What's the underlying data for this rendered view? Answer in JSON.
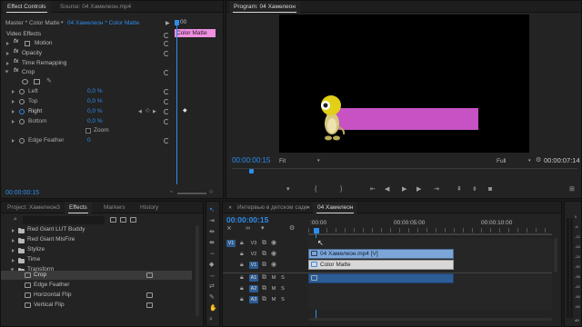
{
  "colors": {
    "accent": "#2d8ceb",
    "clip_pink": "#ef8fe0",
    "matte": "#c652c4",
    "clip_blue": "#7da6d8",
    "clip_matte_bg": "#d8d8d8",
    "video_track": "#2c5c93",
    "audio_track": "#2c5c93"
  },
  "effect_controls": {
    "tab_effect_controls": "Effect Controls",
    "tab_source": "Source: 04 Хамелеон.mp4",
    "master_label": "Master * Color Matte",
    "sequence_label": "04 Хамелеон * Color Matte",
    "ruler_time": "00",
    "clip_label": "Color Matte",
    "section_label": "Video Effects",
    "effects": [
      {
        "label": "Motion",
        "icon": "fx-badge"
      },
      {
        "label": "Opacity",
        "icon": "fx-badge"
      },
      {
        "label": "Time Remapping",
        "icon": "fx-badge"
      },
      {
        "label": "Crop",
        "icon": "fx-badge"
      }
    ],
    "crop_params": [
      {
        "label": "Left",
        "value": "0,0 %"
      },
      {
        "label": "Top",
        "value": "0,0 %"
      },
      {
        "label": "Right",
        "value": "0,0 %"
      },
      {
        "label": "Bottom",
        "value": "0,0 %"
      }
    ],
    "zoom_label": "Zoom",
    "edge_feather_label": "Edge Feather",
    "edge_feather_value": "0",
    "timecode": "00:00:00:15"
  },
  "program": {
    "tab_label": "Program: 04 Хамелеон",
    "timecode_current": "00:00:00:15",
    "fit_label": "Fit",
    "quality_label": "Full",
    "timecode_duration": "00:00:07:14"
  },
  "project": {
    "tab_project": "Project: Хамелеон3",
    "tab_effects": "Effects",
    "tab_markers": "Markers",
    "tab_history": "History",
    "items": [
      {
        "label": "Red Giant LUT Buddy",
        "type": "folder"
      },
      {
        "label": "Red Giant MisFire",
        "type": "folder"
      },
      {
        "label": "Stylize",
        "type": "folder"
      },
      {
        "label": "Time",
        "type": "folder"
      },
      {
        "label": "Transform",
        "type": "folder-open"
      },
      {
        "label": "Crop",
        "type": "effect",
        "selected": true
      },
      {
        "label": "Edge Feather",
        "type": "effect"
      },
      {
        "label": "Horizontal Flip",
        "type": "effect"
      },
      {
        "label": "Vertical Flip",
        "type": "effect"
      }
    ]
  },
  "timeline": {
    "tab_other": "Интервью в детском саде",
    "tab_active": "04 Хамелеон",
    "timecode": "00:00:00:15",
    "ruler_labels": [
      ":00:00",
      "00:00:05:00",
      "00:00:10:00"
    ],
    "source_patch": "V1",
    "video_tracks": [
      {
        "name": "V3"
      },
      {
        "name": "V2"
      },
      {
        "name": "V1"
      }
    ],
    "audio_tracks": [
      {
        "name": "A1",
        "m": "M",
        "s": "S"
      },
      {
        "name": "A2",
        "m": "M",
        "s": "S"
      },
      {
        "name": "A3",
        "m": "M",
        "s": "S"
      }
    ],
    "clip_video": "04 Хамелеон.mp4 [V]",
    "clip_matte": "Color Matte",
    "audio_meter_labels": [
      "0",
      "-6",
      "-12",
      "-18",
      "-24",
      "-30",
      "-36",
      "-42",
      "-48",
      "-54"
    ],
    "audio_meter_footer": "dB"
  }
}
